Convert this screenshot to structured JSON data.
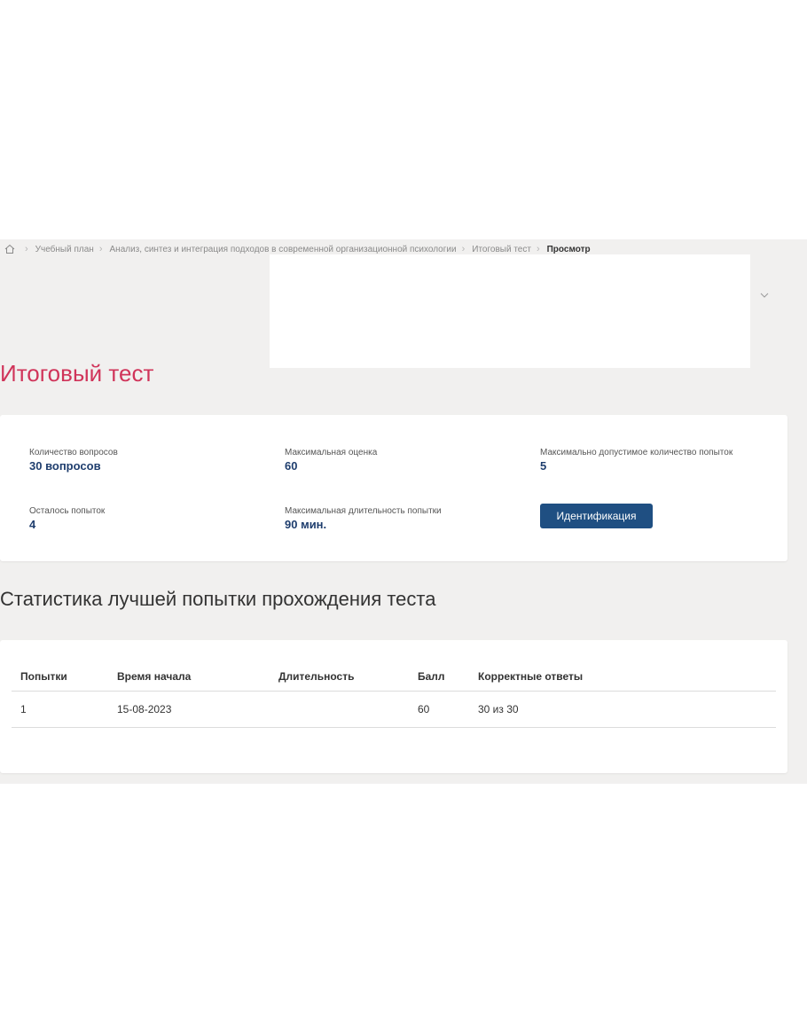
{
  "breadcrumb": {
    "items": [
      "Учебный план",
      "Анализ, синтез и интеграция подходов в современной организационной психологии",
      "Итоговый тест"
    ],
    "current": "Просмотр"
  },
  "icons": {
    "home": "home-icon",
    "chevron": "chevron-down-icon"
  },
  "page": {
    "title": "Итоговый тест",
    "subtitle": "Статистика лучшей попытки прохождения теста"
  },
  "info": {
    "questions_label": "Количество вопросов",
    "questions_value": "30 вопросов",
    "max_score_label": "Максимальная оценка",
    "max_score_value": "60",
    "max_attempts_label": "Максимально допустимое количество попыток",
    "max_attempts_value": "5",
    "remaining_label": "Осталось попыток",
    "remaining_value": "4",
    "duration_label": "Максимальная длительность попытки",
    "duration_value": "90 мин.",
    "identify_button": "Идентификация"
  },
  "table": {
    "headers": [
      "Попытки",
      "Время начала",
      "Длительность",
      "Балл",
      "Корректные ответы"
    ],
    "rows": [
      [
        "1",
        "15-08-2023",
        "",
        "60",
        "30 из 30"
      ]
    ]
  },
  "colors": {
    "title": "#d0345a",
    "accent": "#1f4f82",
    "value_text": "#1f3e6e",
    "background": "#f1f0ef"
  }
}
